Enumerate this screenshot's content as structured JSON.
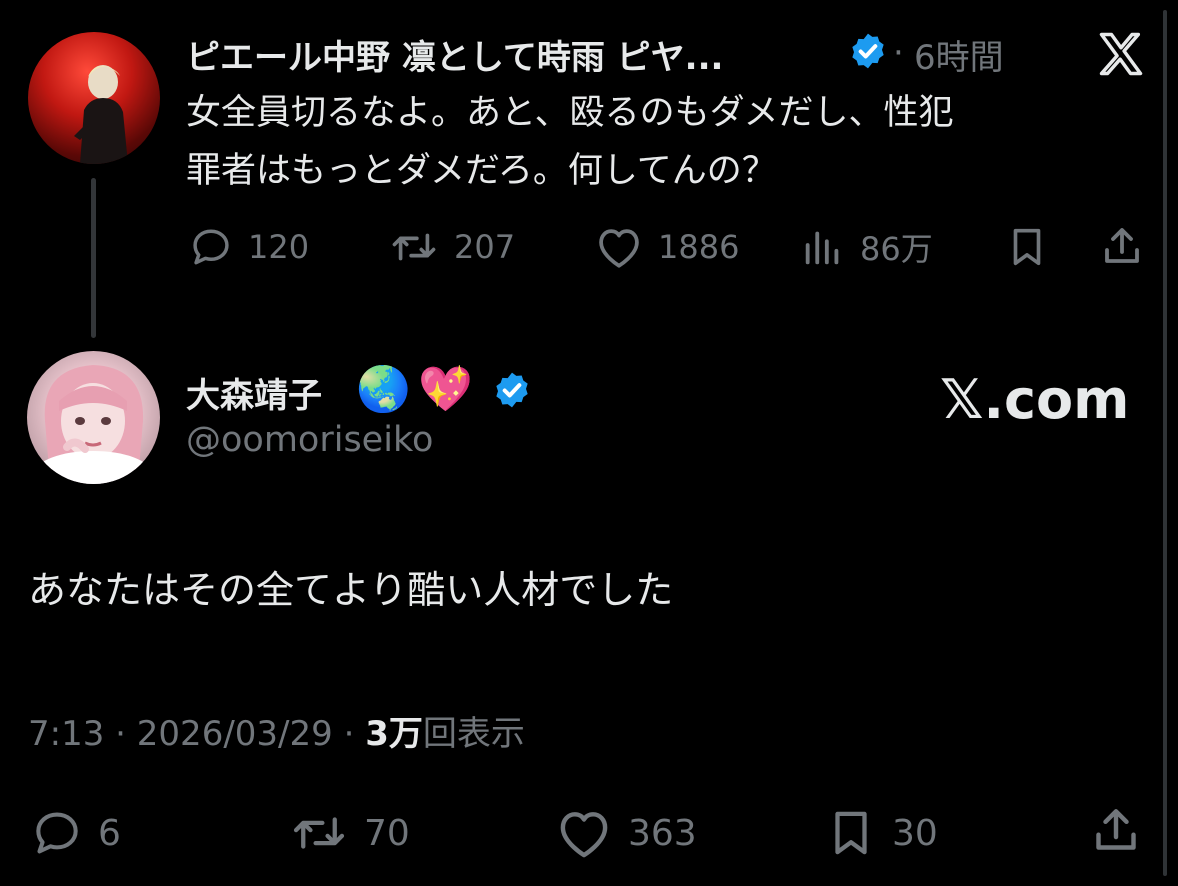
{
  "quoted_tweet": {
    "display_name": "ピエール中野 凛として時雨 ピヤ...",
    "separator": "·",
    "time_ago": "6時間",
    "text_line1": "女全員切るなよ。あと、殴るのもダメだし、性犯",
    "text_line2": "罪者はもっとダメだろ。何してんの？",
    "actions": {
      "replies": "120",
      "retweets": "207",
      "likes": "1886",
      "views": "86万"
    }
  },
  "main_tweet": {
    "display_name": "大森靖子",
    "emojis": [
      "🌏",
      "💖"
    ],
    "handle": "@oomoriseiko",
    "brand": "𝕏.com",
    "text": "あなたはその全てより酷い人材でした",
    "time": "7:13",
    "separator1": "·",
    "date": "2026/03/29",
    "separator2": "·",
    "view_count": "3万",
    "view_suffix": "回表示",
    "actions": {
      "replies": "6",
      "retweets": "70",
      "likes": "363",
      "bookmarks": "30"
    }
  },
  "icons": {
    "x_logo": "x-logo-icon",
    "verified": "verified-badge-icon",
    "reply": "reply-icon",
    "retweet": "retweet-icon",
    "like": "heart-icon",
    "views": "views-chart-icon",
    "bookmark": "bookmark-icon",
    "share": "share-icon"
  },
  "colors": {
    "background": "#000000",
    "text": "#e7e9ea",
    "muted": "#71767b",
    "verified_blue": "#1d9bf0"
  }
}
